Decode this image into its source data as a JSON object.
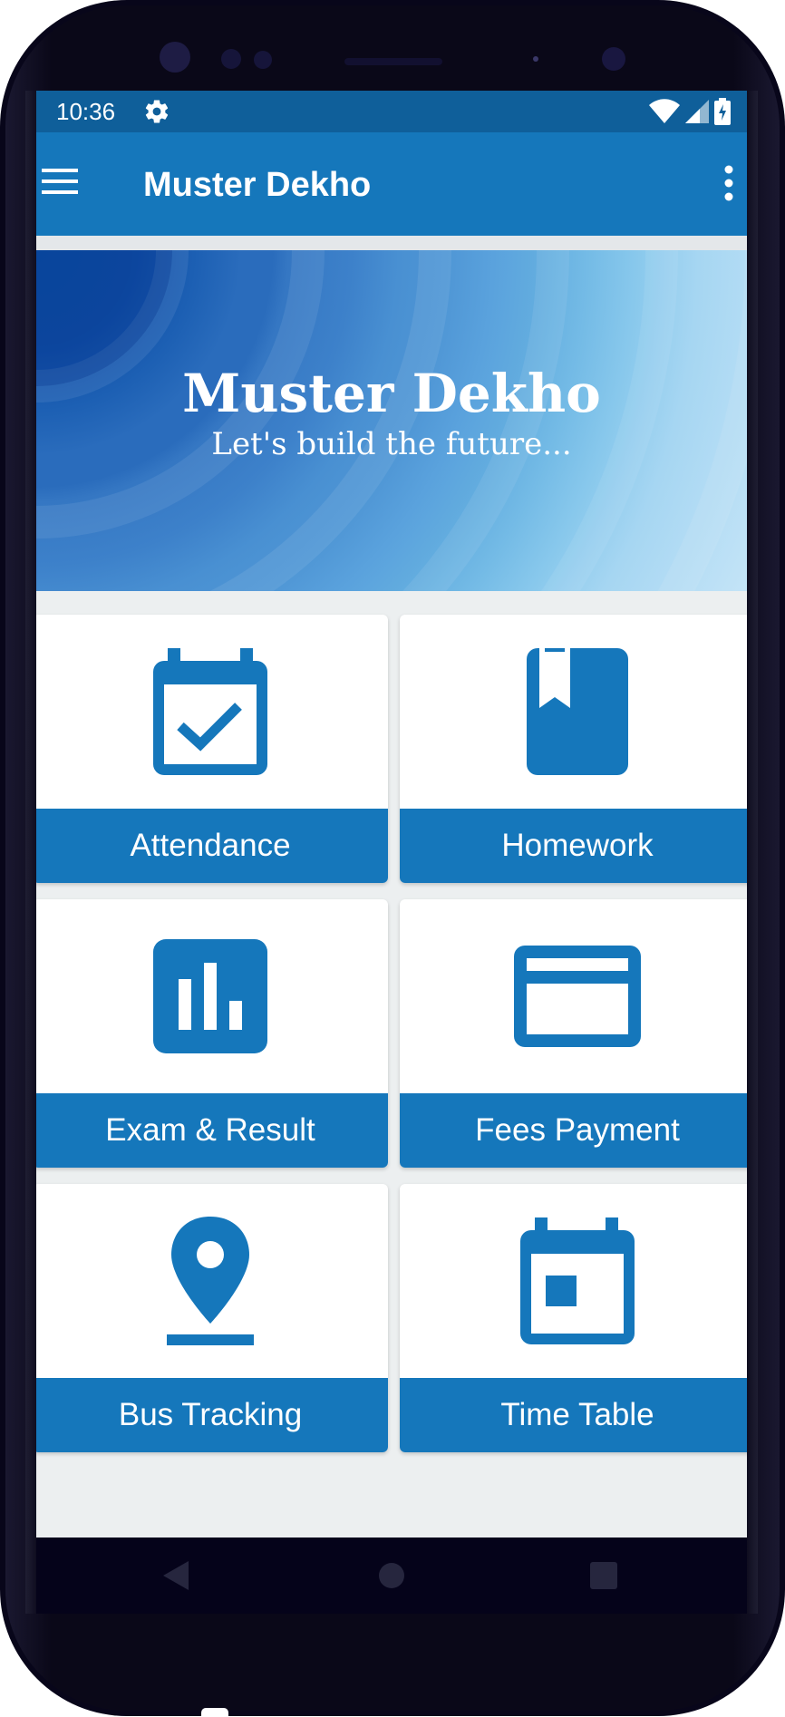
{
  "status_bar": {
    "time": "10:36",
    "icons": [
      "settings-gear-icon",
      "wifi-icon",
      "cell-signal-icon",
      "battery-charging-icon"
    ]
  },
  "app_bar": {
    "title": "Muster Dekho",
    "menu_icon": "hamburger-menu-icon",
    "overflow_icon": "more-vert-icon"
  },
  "banner": {
    "title": "Muster Dekho",
    "subtitle": "Let's build the future..."
  },
  "tiles": [
    {
      "label": "Attendance",
      "icon": "calendar-check-icon"
    },
    {
      "label": "Homework",
      "icon": "book-bookmark-icon"
    },
    {
      "label": "Exam & Result",
      "icon": "bar-chart-icon"
    },
    {
      "label": "Fees Payment",
      "icon": "credit-card-icon"
    },
    {
      "label": "Bus Tracking",
      "icon": "location-pin-icon"
    },
    {
      "label": "Time Table",
      "icon": "calendar-event-icon"
    }
  ],
  "nav_bar": {
    "icons": [
      "back-icon",
      "home-icon",
      "recents-icon"
    ]
  },
  "colors": {
    "primary": "#1577bb",
    "status_bar": "#0f5f9a",
    "background": "#eceff0",
    "frame": "#08061a"
  }
}
